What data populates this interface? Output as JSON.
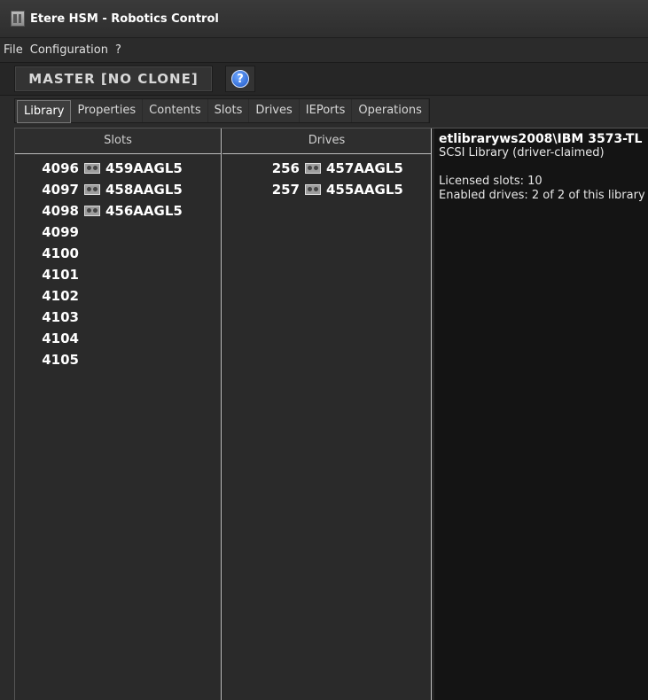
{
  "window": {
    "title": "Etere HSM - Robotics Control"
  },
  "menu": [
    "File",
    "Configuration",
    "?"
  ],
  "toolbar": {
    "master_label": "MASTER [NO CLONE]",
    "help_label": "?"
  },
  "tabs": [
    "Library",
    "Properties",
    "Contents",
    "Slots",
    "Drives",
    "IEPorts",
    "Operations"
  ],
  "active_tab": "Library",
  "slots": {
    "header": "Slots",
    "rows": [
      {
        "num": "4096",
        "tape": "459AAGL5"
      },
      {
        "num": "4097",
        "tape": "458AAGL5"
      },
      {
        "num": "4098",
        "tape": "456AAGL5"
      },
      {
        "num": "4099",
        "tape": ""
      },
      {
        "num": "4100",
        "tape": ""
      },
      {
        "num": "4101",
        "tape": ""
      },
      {
        "num": "4102",
        "tape": ""
      },
      {
        "num": "4103",
        "tape": ""
      },
      {
        "num": "4104",
        "tape": ""
      },
      {
        "num": "4105",
        "tape": ""
      }
    ]
  },
  "drives": {
    "header": "Drives",
    "rows": [
      {
        "num": "256",
        "tape": "457AAGL5"
      },
      {
        "num": "257",
        "tape": "455AAGL5"
      }
    ]
  },
  "info": {
    "library_name": "etlibraryws2008\\IBM 3573-TL",
    "library_type": "SCSI Library (driver-claimed)",
    "licensed_slots": "Licensed slots: 10",
    "enabled_drives": "Enabled drives: 2 of 2 of this library"
  },
  "icons": {
    "app": "library-icon",
    "help": "help-icon",
    "tape": "tape-cartridge-icon"
  }
}
